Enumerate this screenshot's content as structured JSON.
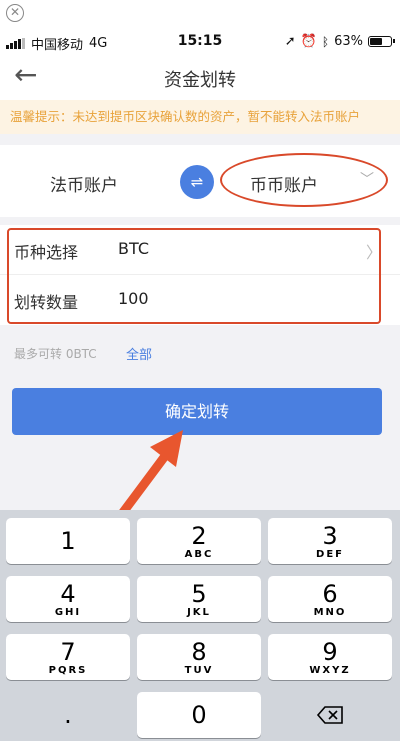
{
  "status_bar": {
    "carrier": "中国移动",
    "network": "4G",
    "time": "15:15",
    "battery_percent": "63%",
    "battery_level": 0.63
  },
  "nav": {
    "title": "资金划转",
    "back_icon": "arrow-left-icon"
  },
  "warning": "温馨提示：未达到提币区块确认数的资产，暂不能转入法币账户",
  "accounts": {
    "from": "法币账户",
    "to": "币币账户",
    "swap_icon": "swap-icon"
  },
  "form": {
    "currency_label": "币种选择",
    "currency_value": "BTC",
    "amount_label": "划转数量",
    "amount_value": "100"
  },
  "max": {
    "text": "最多可转 0BTC",
    "all_label": "全部"
  },
  "confirm_label": "确定划转",
  "keyboard": {
    "keys": [
      {
        "num": "1",
        "letters": ""
      },
      {
        "num": "2",
        "letters": "ABC"
      },
      {
        "num": "3",
        "letters": "DEF"
      },
      {
        "num": "4",
        "letters": "GHI"
      },
      {
        "num": "5",
        "letters": "JKL"
      },
      {
        "num": "6",
        "letters": "MNO"
      },
      {
        "num": "7",
        "letters": "PQRS"
      },
      {
        "num": "8",
        "letters": "TUV"
      },
      {
        "num": "9",
        "letters": "WXYZ"
      },
      {
        "num": ".",
        "letters": ""
      },
      {
        "num": "0",
        "letters": ""
      }
    ]
  },
  "colors": {
    "accent": "#4a7fe0",
    "warning_text": "#e8a23a",
    "warning_bg": "#fdf3e3",
    "annotation": "#d9492a"
  }
}
